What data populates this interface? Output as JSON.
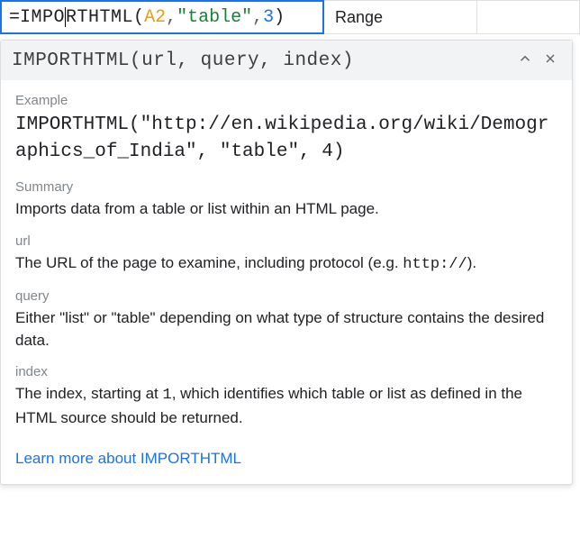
{
  "formula": {
    "func_part1": "IMPO",
    "func_part2": "RTHTML",
    "ref": "A2",
    "str": "\"table\"",
    "num": "3"
  },
  "adjacent_cell": "Range",
  "help": {
    "signature": "IMPORTHTML(url, query, index)",
    "example_label": "Example",
    "example_code": "IMPORTHTML(\"http://en.wikipedia.org/wiki/Demographics_of_India\", \"table\", 4)",
    "summary_label": "Summary",
    "summary_text": "Imports data from a table or list within an HTML page.",
    "params": {
      "url": {
        "name": "url",
        "desc_pre": "The URL of the page to examine, including protocol (e.g. ",
        "desc_code": "http://",
        "desc_post": ")."
      },
      "query": {
        "name": "query",
        "desc": "Either \"list\" or \"table\" depending on what type of structure contains the desired data."
      },
      "index": {
        "name": "index",
        "desc_pre": "The index, starting at ",
        "desc_code": "1",
        "desc_post": ", which identifies which table or list as defined in the HTML source should be returned."
      }
    },
    "learn_more": "Learn more about IMPORTHTML"
  }
}
